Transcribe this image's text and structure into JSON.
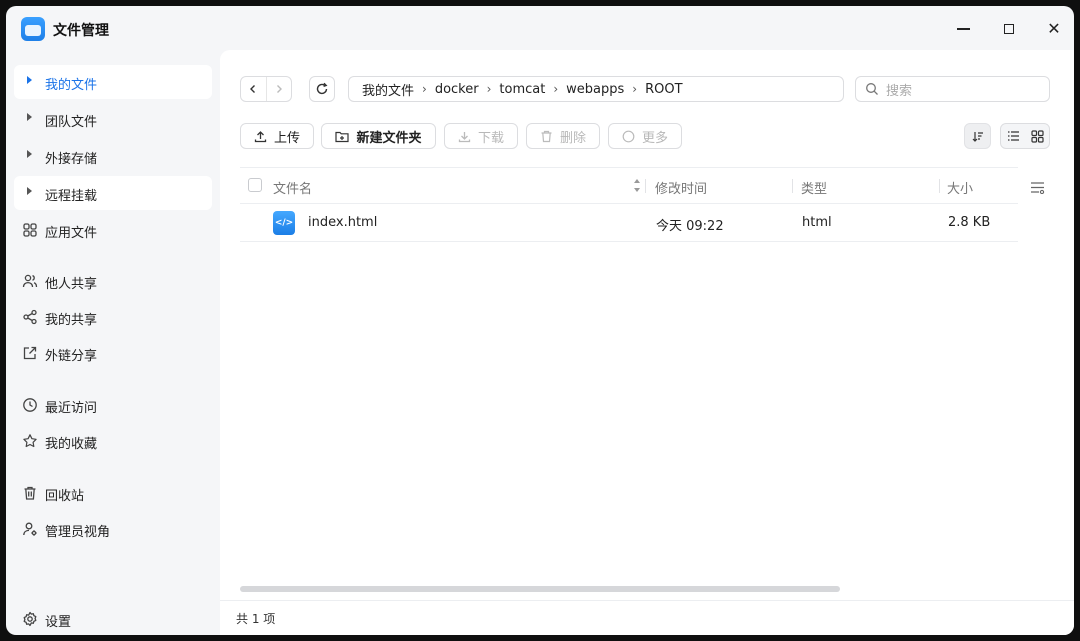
{
  "app": {
    "title": "文件管理"
  },
  "window_controls": {
    "close": "✕"
  },
  "sidebar": {
    "items": [
      {
        "label": "我的文件",
        "icon": "caret-right-icon",
        "selected": true
      },
      {
        "label": "团队文件",
        "icon": "caret-right-icon"
      },
      {
        "label": "外接存储",
        "icon": "caret-right-icon"
      },
      {
        "label": "远程挂载",
        "icon": "caret-right-icon"
      },
      {
        "label": "应用文件",
        "icon": "apps-grid-icon"
      },
      {
        "label": "他人共享",
        "icon": "users-icon"
      },
      {
        "label": "我的共享",
        "icon": "share-icon"
      },
      {
        "label": "外链分享",
        "icon": "external-link-icon"
      },
      {
        "label": "最近访问",
        "icon": "clock-icon"
      },
      {
        "label": "我的收藏",
        "icon": "star-icon"
      },
      {
        "label": "回收站",
        "icon": "trash-icon"
      },
      {
        "label": "管理员视角",
        "icon": "admin-icon"
      }
    ],
    "settings_label": "设置"
  },
  "breadcrumb": [
    "我的文件",
    "docker",
    "tomcat",
    "webapps",
    "ROOT"
  ],
  "search": {
    "placeholder": "搜索"
  },
  "toolbar": {
    "upload": "上传",
    "new_folder": "新建文件夹",
    "download": "下载",
    "delete": "删除",
    "more": "更多"
  },
  "table": {
    "columns": [
      "文件名",
      "修改时间",
      "类型",
      "大小"
    ],
    "rows": [
      {
        "name": "index.html",
        "modified": "今天 09:22",
        "type": "html",
        "size": "2.8 KB",
        "icon": "html-file-icon"
      }
    ]
  },
  "status": {
    "count_text": "共 1 项"
  },
  "colors": {
    "accent": "#1a73e8",
    "window_bg": "#f5f6f8",
    "panel_bg": "#ffffff"
  }
}
